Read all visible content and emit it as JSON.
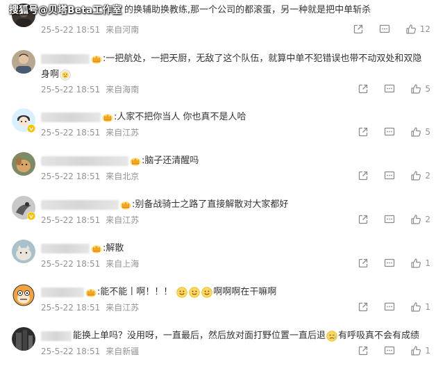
{
  "watermark": "搜狐号@贝塔Beta工作室",
  "colors": {
    "text": "#333333",
    "meta": "#939393",
    "crown": "#f5a623",
    "verified": "#f5c300"
  },
  "comments": [
    {
      "avatar": "dark-photo-avatar",
      "crown": false,
      "verified": false,
      "text": "的换辅助换教练,那一个公司的都滚蛋，另一种就是把中单斩杀",
      "date": "25-5-22 18:51",
      "location": "来自河南",
      "likes": "12"
    },
    {
      "avatar": "portrait-avatar",
      "crown": true,
      "verified": false,
      "text": ":一把航处，一把天厨，无敌了这个队伍，就算中单不犯错误也带不动双处和双隐",
      "text2": "身啊",
      "date": "25-5-22 18:51",
      "location": "来自海南",
      "likes": "5"
    },
    {
      "avatar": "anime-boy-avatar",
      "crown": true,
      "verified": true,
      "text": ":人家不把你当人 你也真不是人哈",
      "date": "25-5-22 18:51",
      "location": "来自江苏",
      "likes": "5"
    },
    {
      "avatar": "dog-avatar",
      "crown": true,
      "verified": false,
      "text": ":脑子还清醒吗",
      "date": "25-5-22 18:51",
      "location": "来自北京",
      "likes": "2"
    },
    {
      "avatar": "bird-avatar",
      "crown": true,
      "verified": true,
      "text": ":别备战骑士之路了直接解散对大家都好",
      "date": "25-5-22 18:51",
      "location": "来自江苏",
      "likes": "2"
    },
    {
      "avatar": "cat-avatar",
      "crown": true,
      "verified": false,
      "text": ":解散",
      "date": "25-5-22 18:51",
      "location": "来自上海",
      "likes": "1"
    },
    {
      "avatar": "cartoon-face-avatar",
      "crown": true,
      "verified": false,
      "text": ":能不能丨啊！！！",
      "text_after": "啊啊啊在干嘛啊",
      "date": "25-5-22 18:51",
      "location": "来自江苏",
      "likes": "1"
    },
    {
      "avatar": "dark-building-avatar",
      "crown": false,
      "verified": false,
      "text": "能换上单吗？没用呀，一直最后，然后放对面打野位置一直后退",
      "text_after": "有呼吸真不会有成绩",
      "date": "25-5-22 18:51",
      "location": "来自新疆",
      "likes": "1"
    }
  ]
}
